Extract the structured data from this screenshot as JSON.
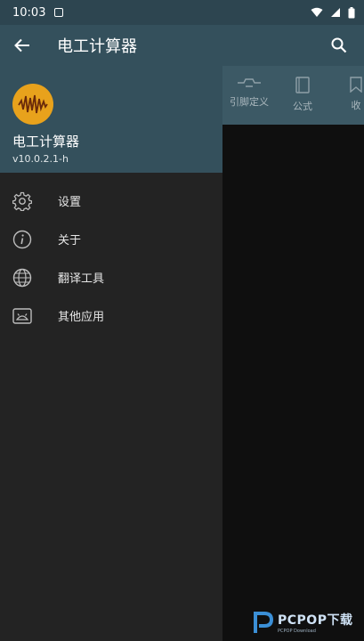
{
  "status_bar": {
    "time": "10:03"
  },
  "app_bar": {
    "title": "电工计算器"
  },
  "drawer": {
    "app_name": "电工计算器",
    "version": "v10.0.2.1-h",
    "menu": [
      {
        "label": "设置",
        "icon": "gear-icon"
      },
      {
        "label": "关于",
        "icon": "info-icon"
      },
      {
        "label": "翻译工具",
        "icon": "globe-icon"
      },
      {
        "label": "其他应用",
        "icon": "android-apps-icon"
      }
    ]
  },
  "tabs": [
    {
      "label": "引脚定义",
      "icon": "pinout-icon"
    },
    {
      "label": "公式",
      "icon": "book-icon"
    },
    {
      "label": "收",
      "icon": "bookmark-icon"
    }
  ],
  "colors": {
    "header": "#34505c",
    "drawer": "#232323",
    "accent": "#e8a21c"
  }
}
